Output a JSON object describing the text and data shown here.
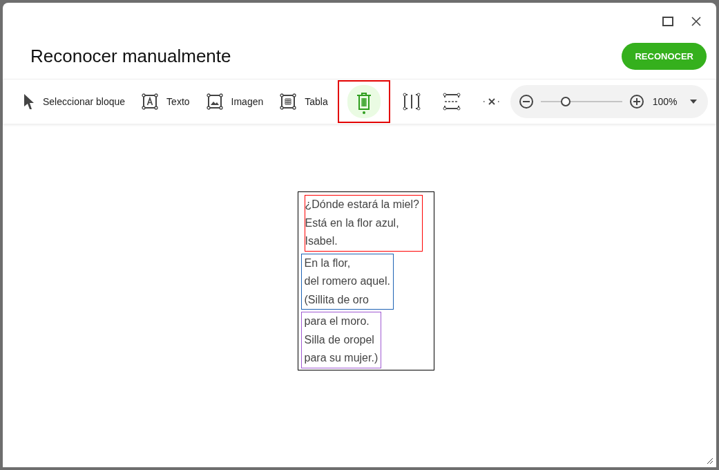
{
  "window": {
    "title": "Reconocer manualmente",
    "primary_button": "RECONOCER"
  },
  "toolbar": {
    "tools": [
      {
        "kind": "select",
        "label": "Seleccionar bloque",
        "selected": false
      },
      {
        "kind": "text",
        "label": "Texto",
        "selected": false
      },
      {
        "kind": "image",
        "label": "Imagen",
        "selected": false
      },
      {
        "kind": "table",
        "label": "Tabla",
        "selected": false
      },
      {
        "kind": "delete",
        "selected": true
      },
      {
        "kind": "split-vertical",
        "selected": false
      },
      {
        "kind": "split-horizontal",
        "selected": false
      },
      {
        "kind": "unsplit",
        "selected": false
      }
    ],
    "zoom": {
      "level": 0.3,
      "reading": "100%"
    }
  },
  "document": {
    "blocks": [
      {
        "color": "#ff0000",
        "lines": [
          "¿Dónde estará la miel?",
          "Está en la flor azul,",
          "Isabel."
        ]
      },
      {
        "color": "#1e63b4",
        "lines": [
          "En la flor,",
          "del romero aquel.",
          "(Sillita de oro"
        ]
      },
      {
        "color": "#a05ad2",
        "lines": [
          "para el moro.",
          "Silla de oropel",
          "para su mujer.)"
        ]
      }
    ]
  }
}
